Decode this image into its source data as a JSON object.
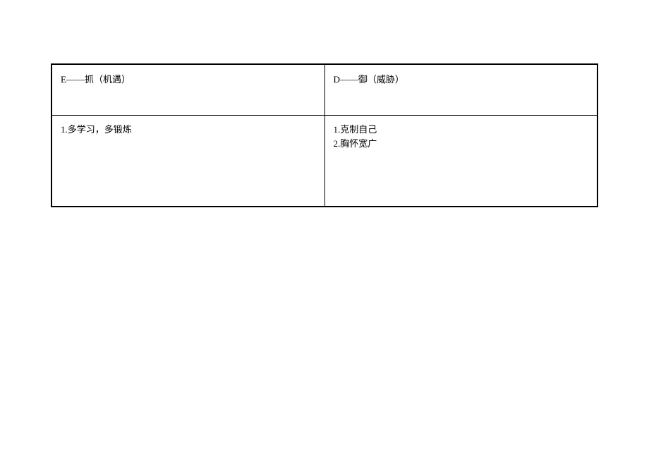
{
  "table": {
    "headers": {
      "left": "E——抓（机遇）",
      "right": "D——御（威胁）"
    },
    "content": {
      "left_line1": "1.多学习，多锻炼",
      "right_line1": "1.克制自己",
      "right_line2": "2.胸怀宽广"
    }
  }
}
